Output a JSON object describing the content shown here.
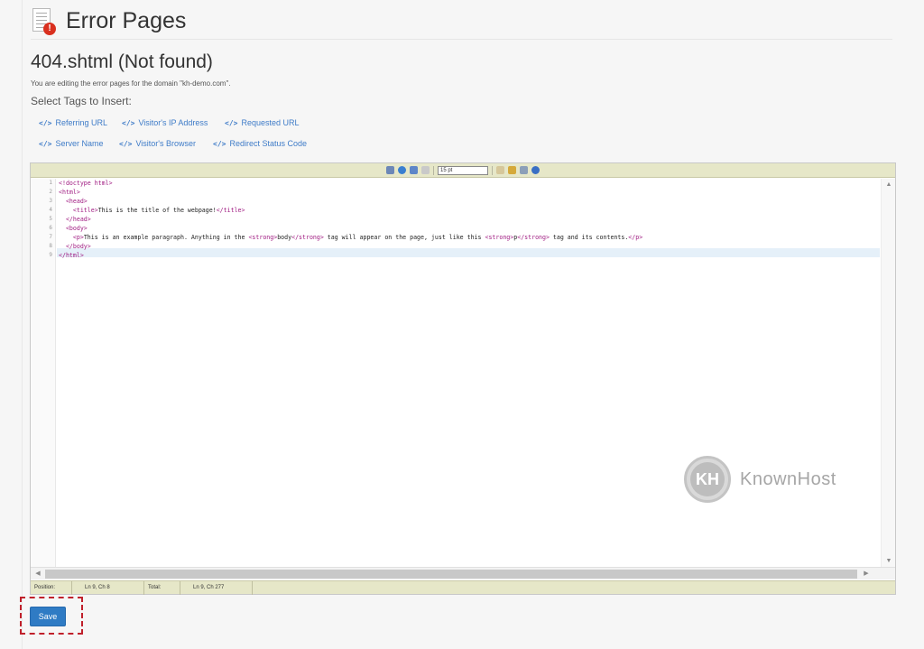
{
  "header": {
    "title": "Error Pages",
    "icon": "error-document-icon"
  },
  "subtitle": "404.shtml (Not found)",
  "editing_note": "You are editing the error pages for the domain \"kh-demo.com\".",
  "tags_label": "Select Tags to Insert:",
  "tags": [
    {
      "label": "Referring URL",
      "icon": "code-icon"
    },
    {
      "label": "Visitor's IP Address",
      "icon": "code-icon"
    },
    {
      "label": "Requested URL",
      "icon": "code-icon"
    },
    {
      "label": "Server Name",
      "icon": "code-icon"
    },
    {
      "label": "Visitor's Browser",
      "icon": "code-icon"
    },
    {
      "label": "Redirect Status Code",
      "icon": "code-icon"
    }
  ],
  "editor": {
    "toolbar_select": "15 pt",
    "line_numbers": [
      "1",
      "2",
      "3",
      "4",
      "5",
      "6",
      "7",
      "8",
      "9"
    ],
    "lines": [
      "<!doctype html>",
      "<html>",
      "  <head>",
      "    <title>This is the title of the webpage!</title>",
      "  </head>",
      "  <body>",
      "    <p>This is an example paragraph. Anything in the <strong>body</strong> tag will appear on the page, just like this <strong>p</strong> tag and its contents.</p>",
      "  </body>",
      "</html>"
    ],
    "status": {
      "position_label": "Position:",
      "position_value": "Ln 9, Ch 8",
      "total_label": "Total:",
      "total_value": "Ln 9, Ch 277"
    }
  },
  "watermark": {
    "text": "KnownHost",
    "logo_letters": "KH"
  },
  "save_label": "Save",
  "colors": {
    "link": "#3f7cc8",
    "toolbar": "#e6e7c8",
    "save": "#2f7bc4",
    "highlight": "#c0202b",
    "tag_code": "#a01c82"
  }
}
